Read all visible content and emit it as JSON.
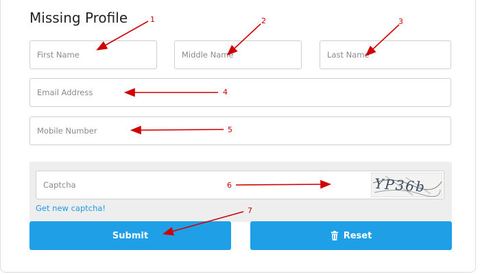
{
  "form": {
    "title": "Missing Profile",
    "first_name_placeholder": "First Name",
    "middle_name_placeholder": "Middle Name",
    "last_name_placeholder": "Last Name",
    "email_placeholder": "Email Address",
    "mobile_placeholder": "Mobile Number",
    "captcha_placeholder": "Captcha",
    "captcha_text": "YP36b",
    "new_captcha_link": "Get new captcha!",
    "submit_label": "Submit",
    "reset_label": "Reset",
    "reset_icon": "trash-icon"
  },
  "annotations": {
    "color": "#d00000",
    "labels": [
      "1",
      "2",
      "3",
      "4",
      "5",
      "6",
      "7"
    ]
  },
  "colors": {
    "button": "#1f9fe6",
    "link": "#1b9be0",
    "captcha_bg": "#eeeeee"
  }
}
